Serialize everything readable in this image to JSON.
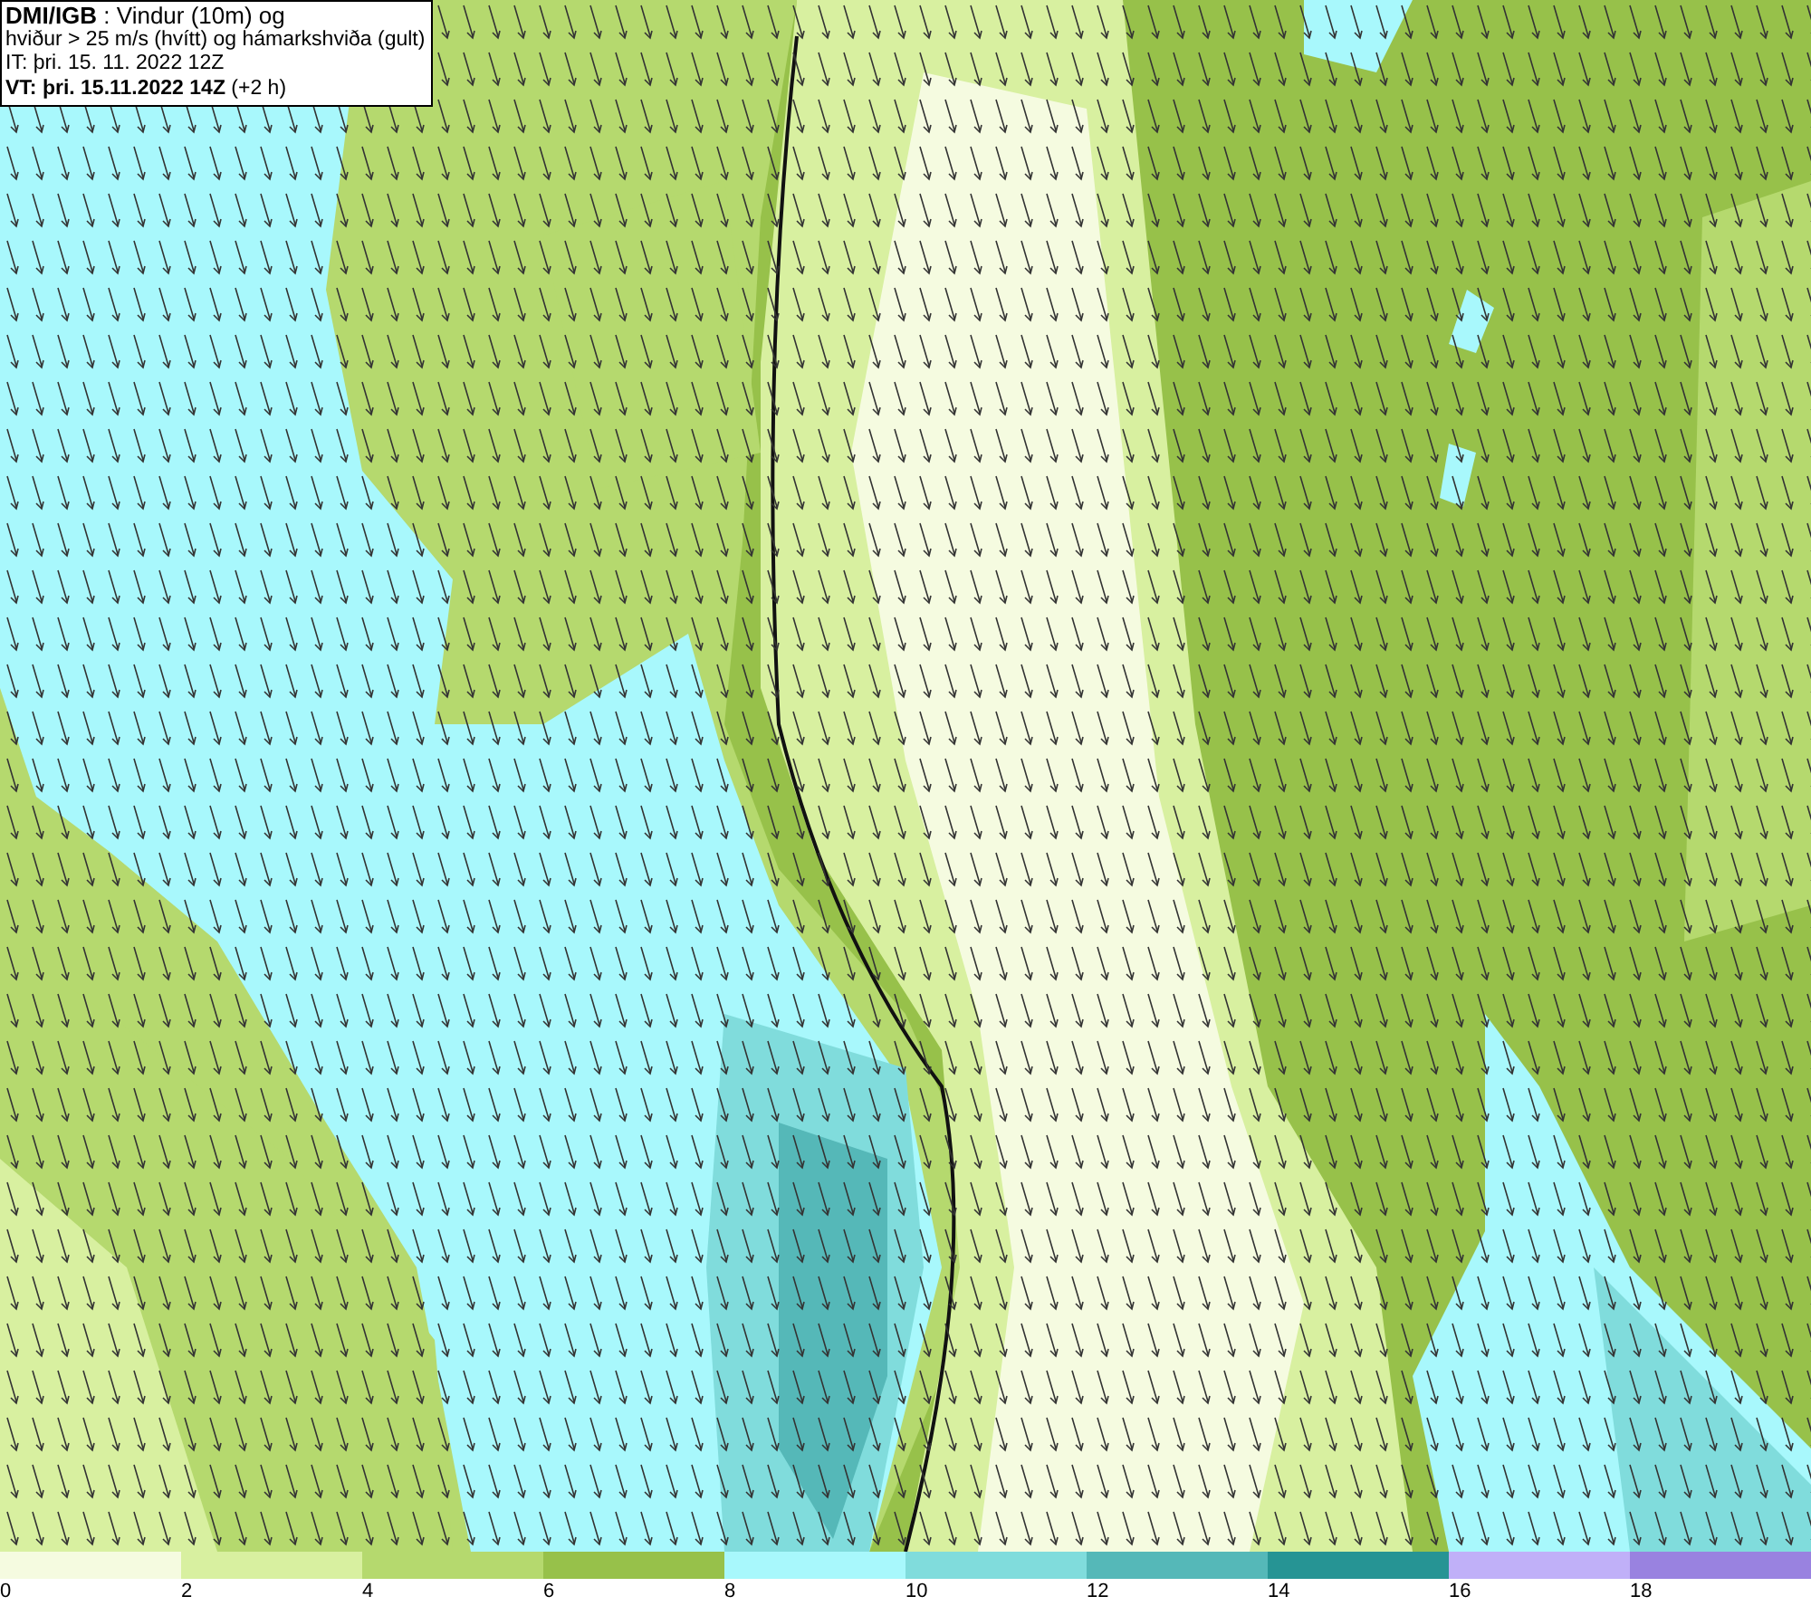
{
  "header": {
    "lines": [
      "**DMI/IGB** : Vindur (10m) og",
      "hviður > 25 m/s (hvítt) og hámarkshviða (gult)",
      "IT: þri. 15. 11. 2022 12Z",
      "**VT: þri. 15.11.2022 14Z** (+2 h)"
    ]
  },
  "legend": {
    "bins": [
      {
        "tick": "0",
        "color": "#f5fbe0"
      },
      {
        "tick": "2",
        "color": "#d8f0a0"
      },
      {
        "tick": "4",
        "color": "#b5d96e"
      },
      {
        "tick": "6",
        "color": "#97c14a"
      },
      {
        "tick": "8",
        "color": "#a8f8fc"
      },
      {
        "tick": "10",
        "color": "#80dcdc"
      },
      {
        "tick": "12",
        "color": "#55b8b8"
      },
      {
        "tick": "14",
        "color": "#269494"
      },
      {
        "tick": "16",
        "color": "#c0b0f8"
      },
      {
        "tick": "18",
        "color": "#9982e0"
      }
    ]
  }
}
